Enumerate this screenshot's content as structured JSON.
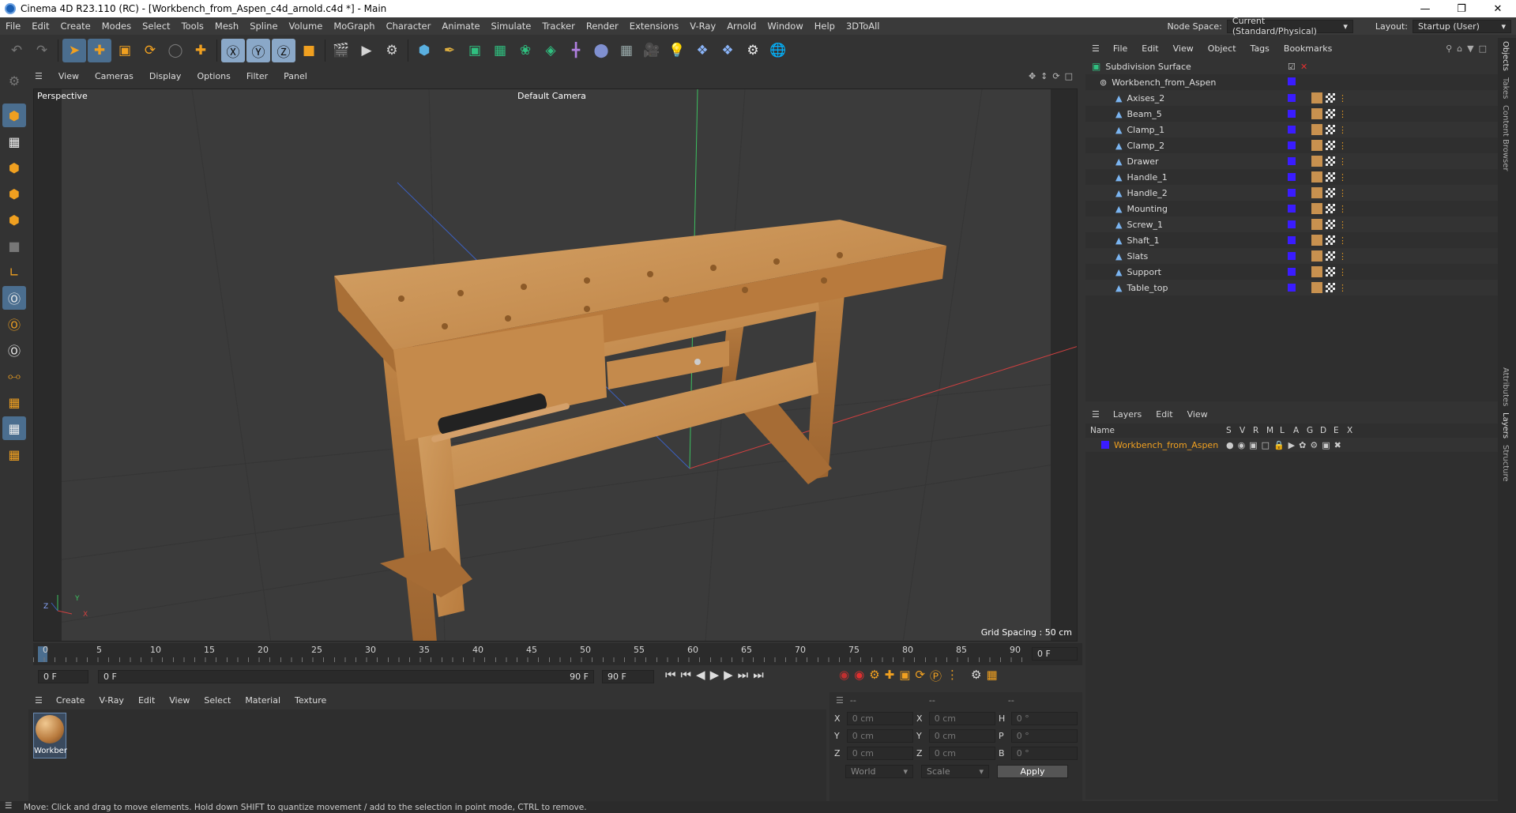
{
  "window": {
    "title": "Cinema 4D R23.110 (RC) - [Workbench_from_Aspen_c4d_arnold.c4d *] - Main"
  },
  "menubar": {
    "items": [
      "File",
      "Edit",
      "Create",
      "Modes",
      "Select",
      "Tools",
      "Mesh",
      "Spline",
      "Volume",
      "MoGraph",
      "Character",
      "Animate",
      "Simulate",
      "Tracker",
      "Render",
      "Extensions",
      "V-Ray",
      "Arnold",
      "Window",
      "Help",
      "3DToAll"
    ],
    "node_space_label": "Node Space:",
    "node_space_value": "Current (Standard/Physical)",
    "layout_label": "Layout:",
    "layout_value": "Startup (User)"
  },
  "viewport": {
    "menu": [
      "View",
      "Cameras",
      "Display",
      "Options",
      "Filter",
      "Panel"
    ],
    "label": "Perspective",
    "camera": "Default Camera",
    "grid_spacing": "Grid Spacing : 50 cm",
    "axis_x": "X",
    "axis_y": "Y",
    "axis_z": "Z"
  },
  "timeline": {
    "ticks": [
      "0",
      "5",
      "10",
      "15",
      "20",
      "25",
      "30",
      "35",
      "40",
      "45",
      "50",
      "55",
      "60",
      "65",
      "70",
      "75",
      "80",
      "85",
      "90"
    ],
    "current_frame": "0 F",
    "start_field": "0 F",
    "range_start": "0 F",
    "range_end": "90 F",
    "end_field": "90 F"
  },
  "materials": {
    "menu": [
      "Create",
      "V-Ray",
      "Edit",
      "View",
      "Select",
      "Material",
      "Texture"
    ],
    "items": [
      {
        "name": "Workber"
      }
    ]
  },
  "coords": {
    "headers": [
      "--",
      "--",
      "--"
    ],
    "rows": [
      {
        "a": "X",
        "av": "0 cm",
        "b": "X",
        "bv": "0 cm",
        "c": "H",
        "cv": "0 °"
      },
      {
        "a": "Y",
        "av": "0 cm",
        "b": "Y",
        "bv": "0 cm",
        "c": "P",
        "cv": "0 °"
      },
      {
        "a": "Z",
        "av": "0 cm",
        "b": "Z",
        "bv": "0 cm",
        "c": "B",
        "cv": "0 °"
      }
    ],
    "world": "World",
    "scale": "Scale",
    "apply": "Apply"
  },
  "objects": {
    "menu": [
      "File",
      "Edit",
      "View",
      "Object",
      "Tags",
      "Bookmarks"
    ],
    "root": "Subdivision Surface",
    "group": "Workbench_from_Aspen",
    "children": [
      "Axises_2",
      "Beam_5",
      "Clamp_1",
      "Clamp_2",
      "Drawer",
      "Handle_1",
      "Handle_2",
      "Mounting",
      "Screw_1",
      "Shaft_1",
      "Slats",
      "Support",
      "Table_top"
    ]
  },
  "layers": {
    "menu": [
      "Layers",
      "Edit",
      "View"
    ],
    "columns": [
      "Name",
      "S",
      "V",
      "R",
      "M",
      "L",
      "A",
      "G",
      "D",
      "E",
      "X"
    ],
    "items": [
      {
        "name": "Workbench_from_Aspen",
        "color": "#3a1cff"
      }
    ]
  },
  "sidetabs": [
    "Objects",
    "Takes",
    "Content Browser",
    "Attributes",
    "Layers",
    "Structure"
  ],
  "status": "Move: Click and drag to move elements. Hold down SHIFT to quantize movement / add to the selection in point mode, CTRL to remove.",
  "colors": {
    "accent": "#4b6e8f",
    "layer_blue": "#3a1cff",
    "wood": "#c8914f",
    "highlight_orange": "#f0a020"
  }
}
